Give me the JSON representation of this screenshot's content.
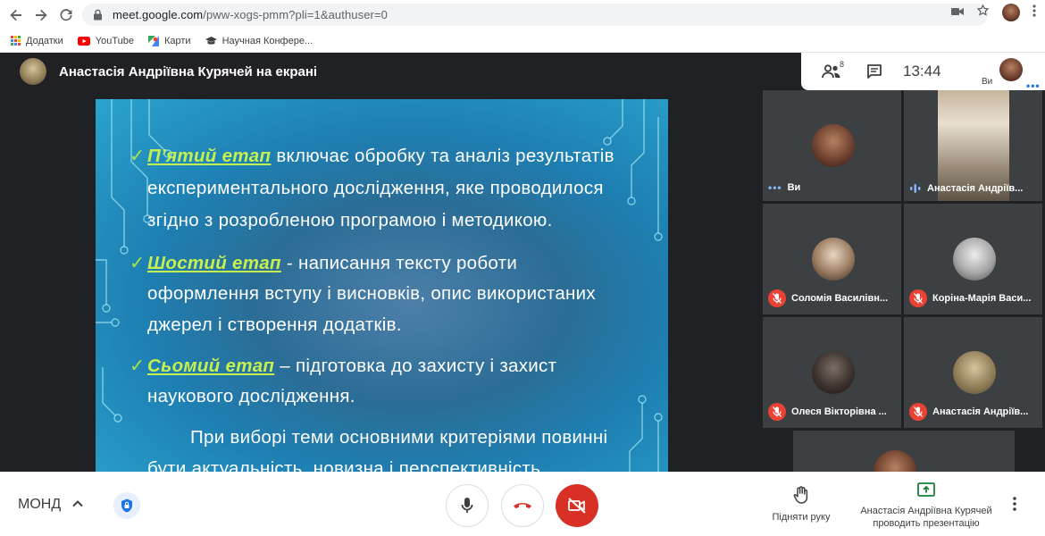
{
  "browser": {
    "url_host": "meet.google.com",
    "url_path": "/pww-xogs-pmm?pli=1&authuser=0",
    "bookmarks": [
      {
        "label": "Додатки",
        "icon": "apps-grid-icon"
      },
      {
        "label": "YouTube",
        "icon": "youtube-icon"
      },
      {
        "label": "Карти",
        "icon": "maps-icon"
      },
      {
        "label": "Научная Конфере...",
        "icon": "graduation-cap-icon"
      }
    ]
  },
  "meet": {
    "presenter_title": "Анастасія Андріївна Курячей на екрані",
    "participants_count": "8",
    "clock": "13:44",
    "me_label": "Ви",
    "me_dots": "•••",
    "slide": {
      "lines": [
        {
          "check": "✓",
          "stage": "П’ятий етап",
          "text": " включає обробку та аналіз результатів"
        },
        {
          "text": "експериментального дослідження, яке проводилося"
        },
        {
          "text": "згідно з розробленою програмою і методикою."
        },
        {
          "check": "✓",
          "stage": "Шостий етап",
          "text": " - написання тексту роботи"
        },
        {
          "text": "оформлення вступу і висновків, опис використаних"
        },
        {
          "text": "джерел і створення додатків."
        },
        {
          "check": "✓",
          "stage": "Сьомий етап",
          "text": " – підготовка до захисту і захист"
        },
        {
          "text": "наукового дослідження."
        },
        {
          "text": "        При виборі теми основними критеріями повинні"
        },
        {
          "text": "бути актуальність, новизна і перспективність"
        }
      ]
    },
    "tiles": [
      {
        "name": "Ви",
        "state": "speaking-dots"
      },
      {
        "name": "Анастасія Андріїв...",
        "state": "speaking-bars"
      },
      {
        "name": "Соломія Василівн...",
        "state": "muted"
      },
      {
        "name": "Коріна-Марія Васи...",
        "state": "muted"
      },
      {
        "name": "Олеся Вікторівна ...",
        "state": "muted"
      },
      {
        "name": "Анастасія Андріїв...",
        "state": "muted"
      }
    ]
  },
  "bottom": {
    "meeting_code": "МОНД",
    "raise_hand": "Підняти руку",
    "presenting": "Анастасія Андріївна Курячей проводить презентацію"
  },
  "colors": {
    "meet_bg": "#202124",
    "tile_bg": "#3c4043",
    "hangup_red": "#d93025",
    "mute_red": "#ea4335",
    "accent_blue": "#1a73e8",
    "slide_highlight": "#c6f04e"
  }
}
